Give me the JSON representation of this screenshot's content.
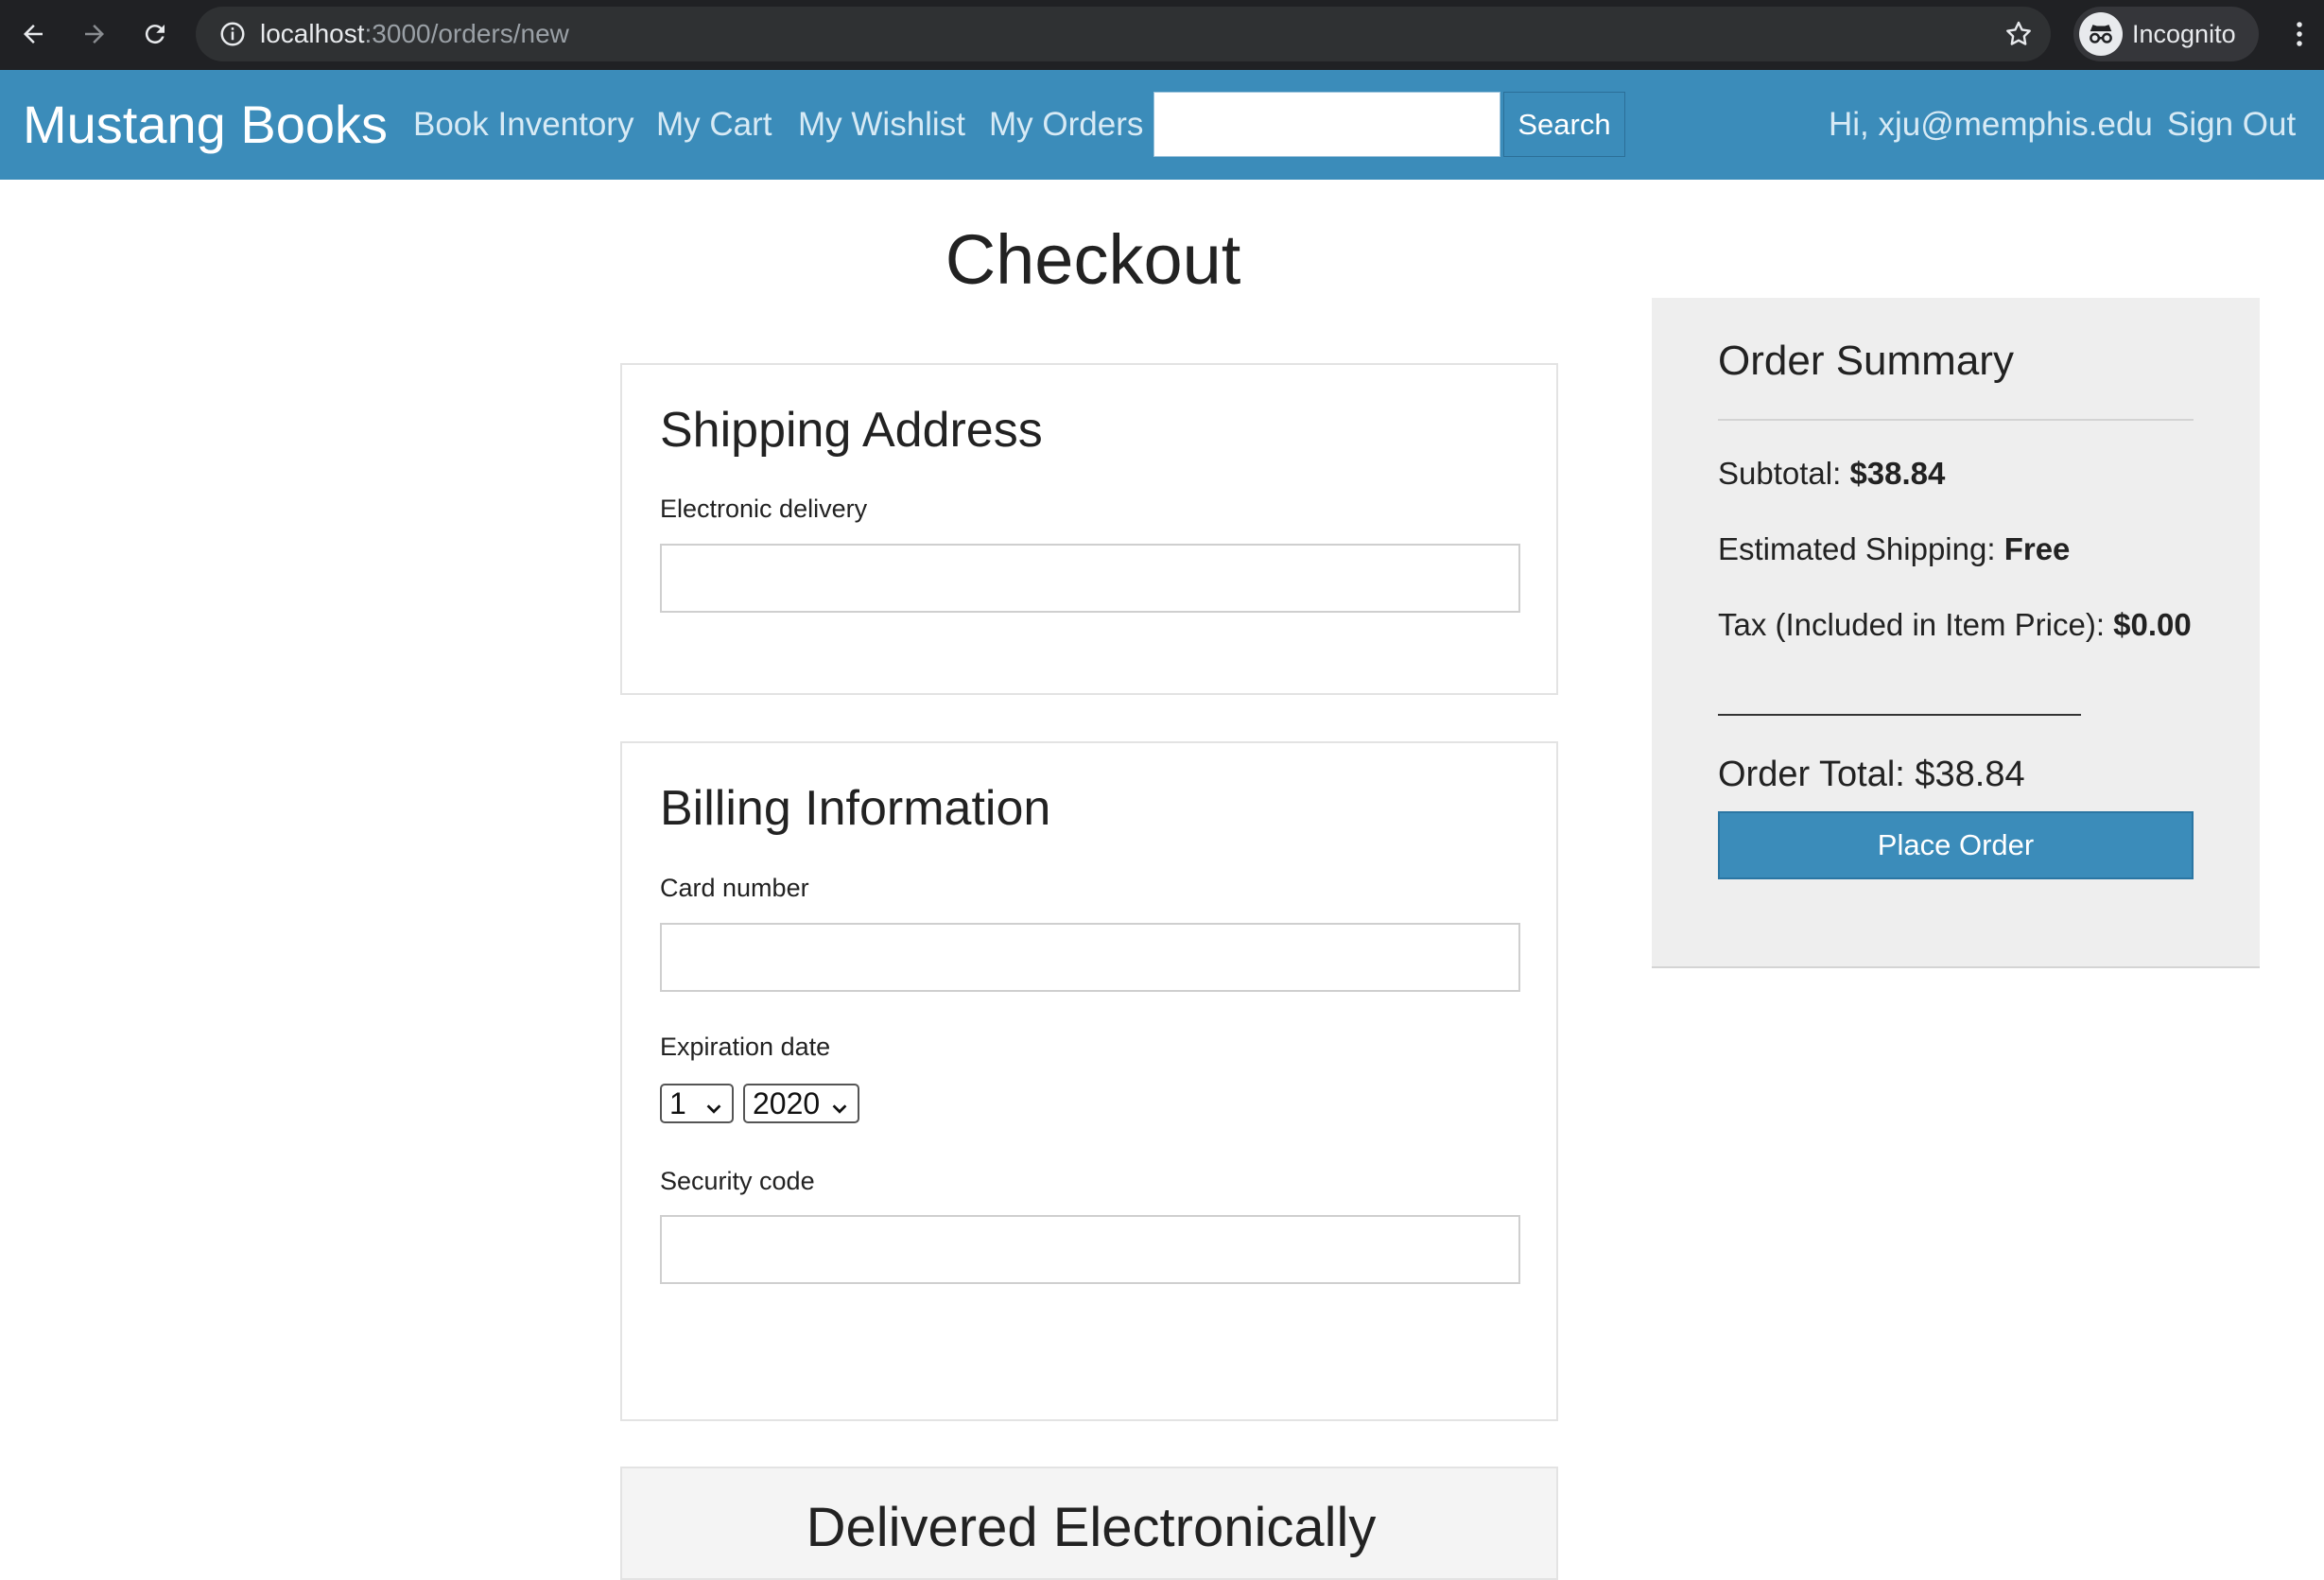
{
  "browser": {
    "url_host": "localhost",
    "url_path": ":3000/orders/new",
    "profile_label": "Incognito"
  },
  "navbar": {
    "brand": "Mustang Books",
    "links": [
      "Book Inventory",
      "My Cart",
      "My Wishlist",
      "My Orders"
    ],
    "search_value": "",
    "search_button": "Search",
    "greeting": "Hi, xju@memphis.edu",
    "sign_out": "Sign Out"
  },
  "page": {
    "title": "Checkout"
  },
  "shipping": {
    "title": "Shipping Address",
    "field_label": "Electronic delivery",
    "field_value": ""
  },
  "billing": {
    "title": "Billing Information",
    "card_label": "Card number",
    "card_value": "",
    "expiration_label": "Expiration date",
    "exp_month": "1",
    "exp_year": "2020",
    "security_label": "Security code",
    "security_value": ""
  },
  "delivery": {
    "title": "Delivered Electronically"
  },
  "summary": {
    "title": "Order Summary",
    "subtotal_label": "Subtotal:",
    "subtotal_value": "$38.84",
    "shipping_label": "Estimated Shipping:",
    "shipping_value": "Free",
    "tax_label": "Tax (Included in Item Price):",
    "tax_value": "$0.00",
    "total_label": "Order Total:",
    "total_value": "$38.84",
    "place_order": "Place Order"
  },
  "colors": {
    "navbar": "#3b8cba",
    "chrome": "#202124",
    "summary_bg": "#eeeeee"
  }
}
